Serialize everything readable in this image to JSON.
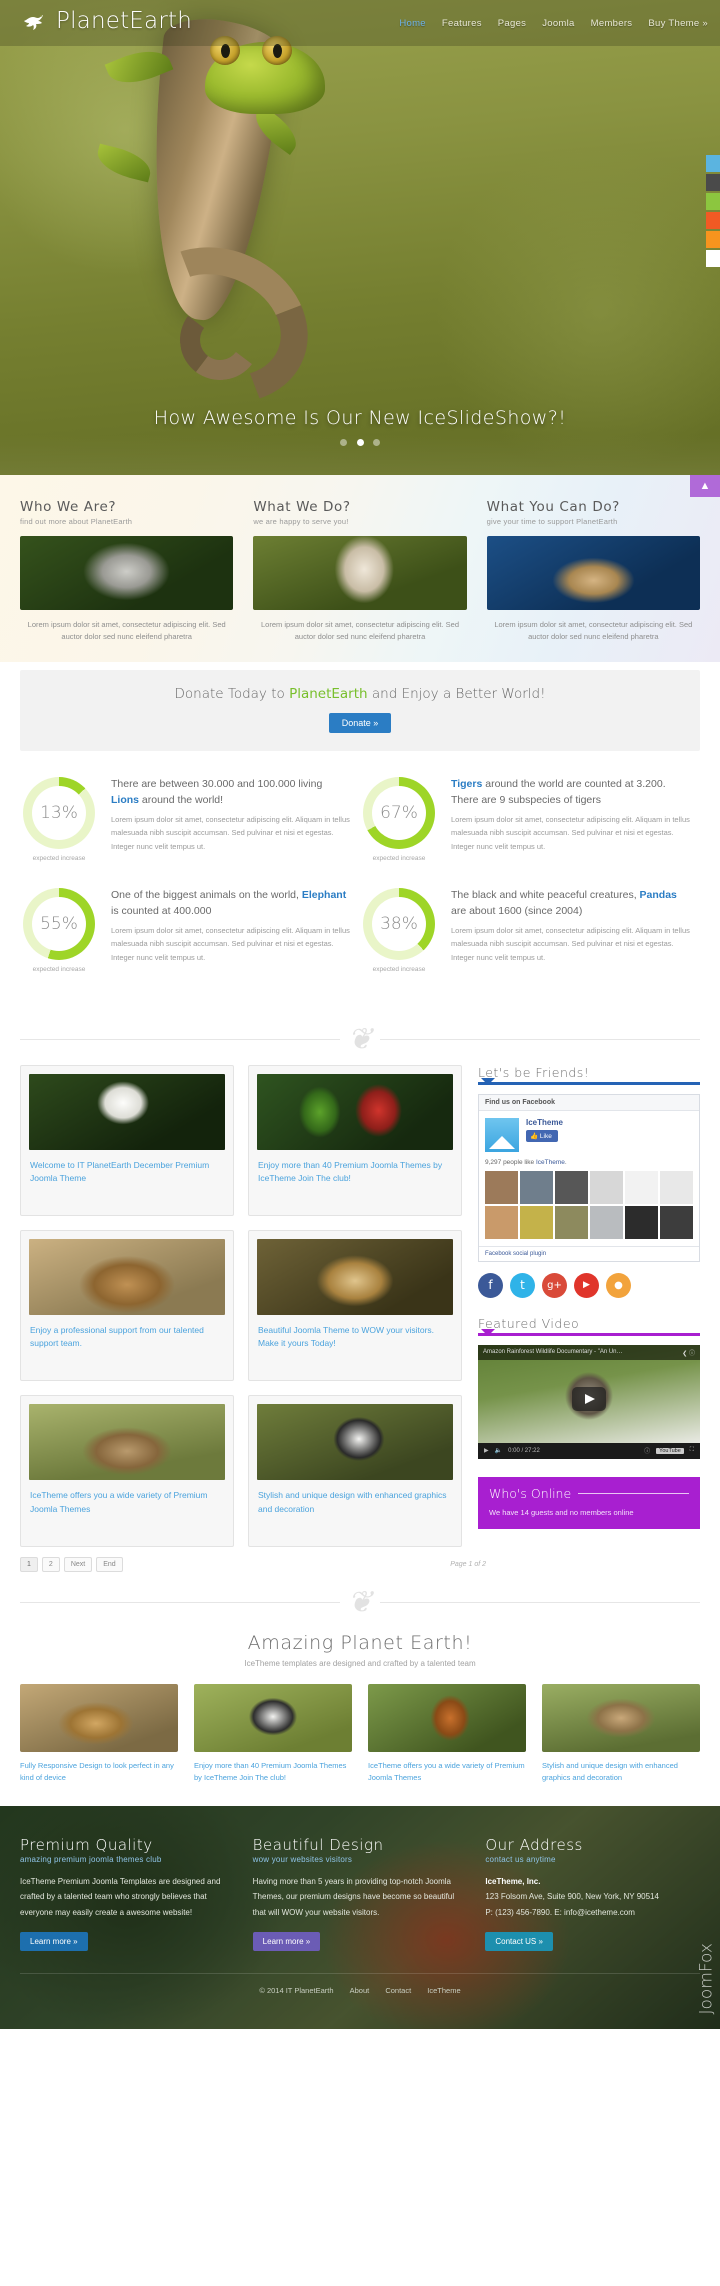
{
  "header": {
    "brand": "PlanetEarth",
    "brand_icon": "bird-logo-icon",
    "nav": [
      {
        "label": "Home",
        "active": true
      },
      {
        "label": "Features",
        "active": false
      },
      {
        "label": "Pages",
        "active": false
      },
      {
        "label": "Joomla",
        "active": false
      },
      {
        "label": "Members",
        "active": false
      },
      {
        "label": "Buy Theme »",
        "active": false
      }
    ]
  },
  "hero": {
    "caption": "How Awesome Is Our New IceSlideShow?!",
    "slides": 3,
    "active_slide": 2,
    "side_tabs": [
      "#5bb4e0",
      "#4a4a4a",
      "#8cc63f",
      "#f15a24",
      "#f7941e",
      "#ffffff"
    ]
  },
  "features": {
    "scroll_top_icon": "chevron-up-icon",
    "columns": [
      {
        "title": "Who We Are?",
        "subtitle": "find out more about PlanetEarth",
        "image": "snow-leopard-photo",
        "caption": "Lorem ipsum dolor sit amet, consectetur adipiscing elit. Sed auctor dolor sed nunc eleifend pharetra"
      },
      {
        "title": "What We Do?",
        "subtitle": "we are happy to serve you!",
        "image": "falcon-photo",
        "caption": "Lorem ipsum dolor sit amet, consectetur adipiscing elit. Sed auctor dolor sed nunc eleifend pharetra"
      },
      {
        "title": "What You Can Do?",
        "subtitle": "give your time to support PlanetEarth",
        "image": "octopus-photo",
        "caption": "Lorem ipsum dolor sit amet, consectetur adipiscing elit. Sed auctor dolor sed nunc eleifend pharetra"
      }
    ]
  },
  "donate": {
    "text_before": "Donate Today to ",
    "highlight": "PlanetEarth",
    "text_after": " and Enjoy a Better World!",
    "button": "Donate »"
  },
  "chart_data": {
    "type": "pie",
    "title": "Expected increase donut gauges",
    "legend_position": "below-each",
    "track_color": "#e9f5c8",
    "fill_color": "#9ed527",
    "items": [
      {
        "percent": 13,
        "value_label": "13%",
        "caption": "expected increase",
        "heading_before": "There are between 30.000 and 100.000 living ",
        "heading_link": "Lions",
        "heading_after": " around the world!",
        "body": "Lorem ipsum dolor sit amet, consectetur adipiscing elit. Aliquam in tellus malesuada nibh suscipit accumsan. Sed pulvinar et nisi et egestas. Integer nunc velit tempus ut."
      },
      {
        "percent": 67,
        "value_label": "67%",
        "caption": "expected increase",
        "heading_before": "",
        "heading_link": "Tigers",
        "heading_after": " around the world are counted at 3.200. There are 9 subspecies of tigers",
        "body": "Lorem ipsum dolor sit amet, consectetur adipiscing elit. Aliquam in tellus malesuada nibh suscipit accumsan. Sed pulvinar et nisi et egestas. Integer nunc velit tempus ut."
      },
      {
        "percent": 55,
        "value_label": "55%",
        "caption": "expected increase",
        "heading_before": "One of the biggest animals on the world, ",
        "heading_link": "Elephant",
        "heading_after": " is counted at 400.000",
        "body": "Lorem ipsum dolor sit amet, consectetur adipiscing elit. Aliquam in tellus malesuada nibh suscipit accumsan. Sed pulvinar et nisi et egestas. Integer nunc velit tempus ut."
      },
      {
        "percent": 38,
        "value_label": "38%",
        "caption": "expected increase",
        "heading_before": "The black and white peaceful creatures, ",
        "heading_link": "Pandas",
        "heading_after": " are about 1600 (since 2004)",
        "body": "Lorem ipsum dolor sit amet, consectetur adipiscing elit. Aliquam in tellus malesuada nibh suscipit accumsan. Sed pulvinar et nisi et egestas. Integer nunc velit tempus ut."
      }
    ]
  },
  "blog": {
    "posts": [
      {
        "image": "bald-eagle-photo",
        "title": "Welcome to IT PlanetEarth December Premium Joomla Theme"
      },
      {
        "image": "macaw-parrots-photo",
        "title": "Enjoy more than 40 Premium Joomla Themes by IceTheme Join The club!"
      },
      {
        "image": "giraffes-photo",
        "title": "Enjoy a professional support from our talented support team."
      },
      {
        "image": "cheetah-photo",
        "title": "Beautiful Joomla Theme to WOW your visitors. Make it yours Today!"
      },
      {
        "image": "meerkats-photo",
        "title": "IceTheme offers you a wide variety of Premium Joomla Themes"
      },
      {
        "image": "panda-photo",
        "title": "Stylish and unique design with enhanced graphics and decoration"
      }
    ],
    "pagination": {
      "pages": [
        "1",
        "2",
        "Next",
        "End"
      ],
      "current": "1",
      "info": "Page 1 of 2"
    }
  },
  "sidebar": {
    "friends": {
      "title": "Let's be Friends!",
      "facebook": {
        "header": "Find us on Facebook",
        "page_name": "IceTheme",
        "like_label": "Like",
        "count_text_before": "9,297 people like ",
        "count_link": "IceTheme",
        "count_text_after": ".",
        "footer": "Facebook social plugin"
      },
      "social_icons": [
        {
          "name": "facebook-icon",
          "glyph": "f",
          "color": "#3b5998"
        },
        {
          "name": "twitter-icon",
          "glyph": "t",
          "color": "#2fb3e8"
        },
        {
          "name": "google-plus-icon",
          "glyph": "g+",
          "color": "#d94a39"
        },
        {
          "name": "youtube-icon",
          "glyph": "▶",
          "color": "#e0352b"
        },
        {
          "name": "rss-icon",
          "glyph": "≈",
          "color": "#f2a33c"
        }
      ]
    },
    "video": {
      "title": "Featured Video",
      "video_title": "Amazon Rainforest Wildlife Documentary - \"An Un…",
      "time": "0:00 / 27:22",
      "share_icon": "share-icon",
      "info_icon": "info-icon",
      "play_icon": "play-icon",
      "volume_icon": "volume-icon",
      "fullscreen_icon": "fullscreen-icon",
      "brand": "YouTube"
    },
    "online": {
      "title": "Who's Online",
      "text": "We have 14 guests and no members online"
    }
  },
  "amazing": {
    "title": "Amazing Planet Earth!",
    "subtitle": "IceTheme templates are designed and crafted by a talented team",
    "cards": [
      {
        "image": "leopard-photo",
        "text": "Fully Responsive Design to look perfect in any kind of device"
      },
      {
        "image": "plover-bird-photo",
        "text": "Enjoy more than 40 Premium Joomla Themes by IceTheme Join The club!"
      },
      {
        "image": "squirrel-photo",
        "text": "IceTheme offers you a wide variety of Premium Joomla Themes"
      },
      {
        "image": "owl-flying-photo",
        "text": "Stylish and unique design with enhanced graphics and decoration"
      }
    ]
  },
  "footer": {
    "columns": [
      {
        "title": "Premium Quality",
        "subtitle": "amazing premium joomla themes club",
        "body": "IceTheme Premium Joomla Templates are designed and crafted by a talented team who strongly believes that everyone may easily create a awesome website!",
        "button": "Learn more »",
        "button_color": "#1d6fae"
      },
      {
        "title": "Beautiful Design",
        "subtitle": "wow your websites visitors",
        "body": "Having more than 5 years in providing top-notch Joomla Themes, our premium designs have become so beautiful that will WOW your website visitors.",
        "button": "Learn more »",
        "button_color": "#6b5cb5"
      },
      {
        "title": "Our Address",
        "subtitle": "contact us anytime",
        "body_lines": [
          "IceTheme, Inc.",
          "123 Folsom Ave, Suite 900, New York, NY 90514",
          "P: (123) 456-7890. E: info@icetheme.com"
        ],
        "button": "Contact US »",
        "button_color": "#1d8fae"
      }
    ],
    "copyright": "© 2014 IT PlanetEarth",
    "links": [
      "About",
      "Contact",
      "IceTheme"
    ],
    "watermark": "JoomFox"
  }
}
